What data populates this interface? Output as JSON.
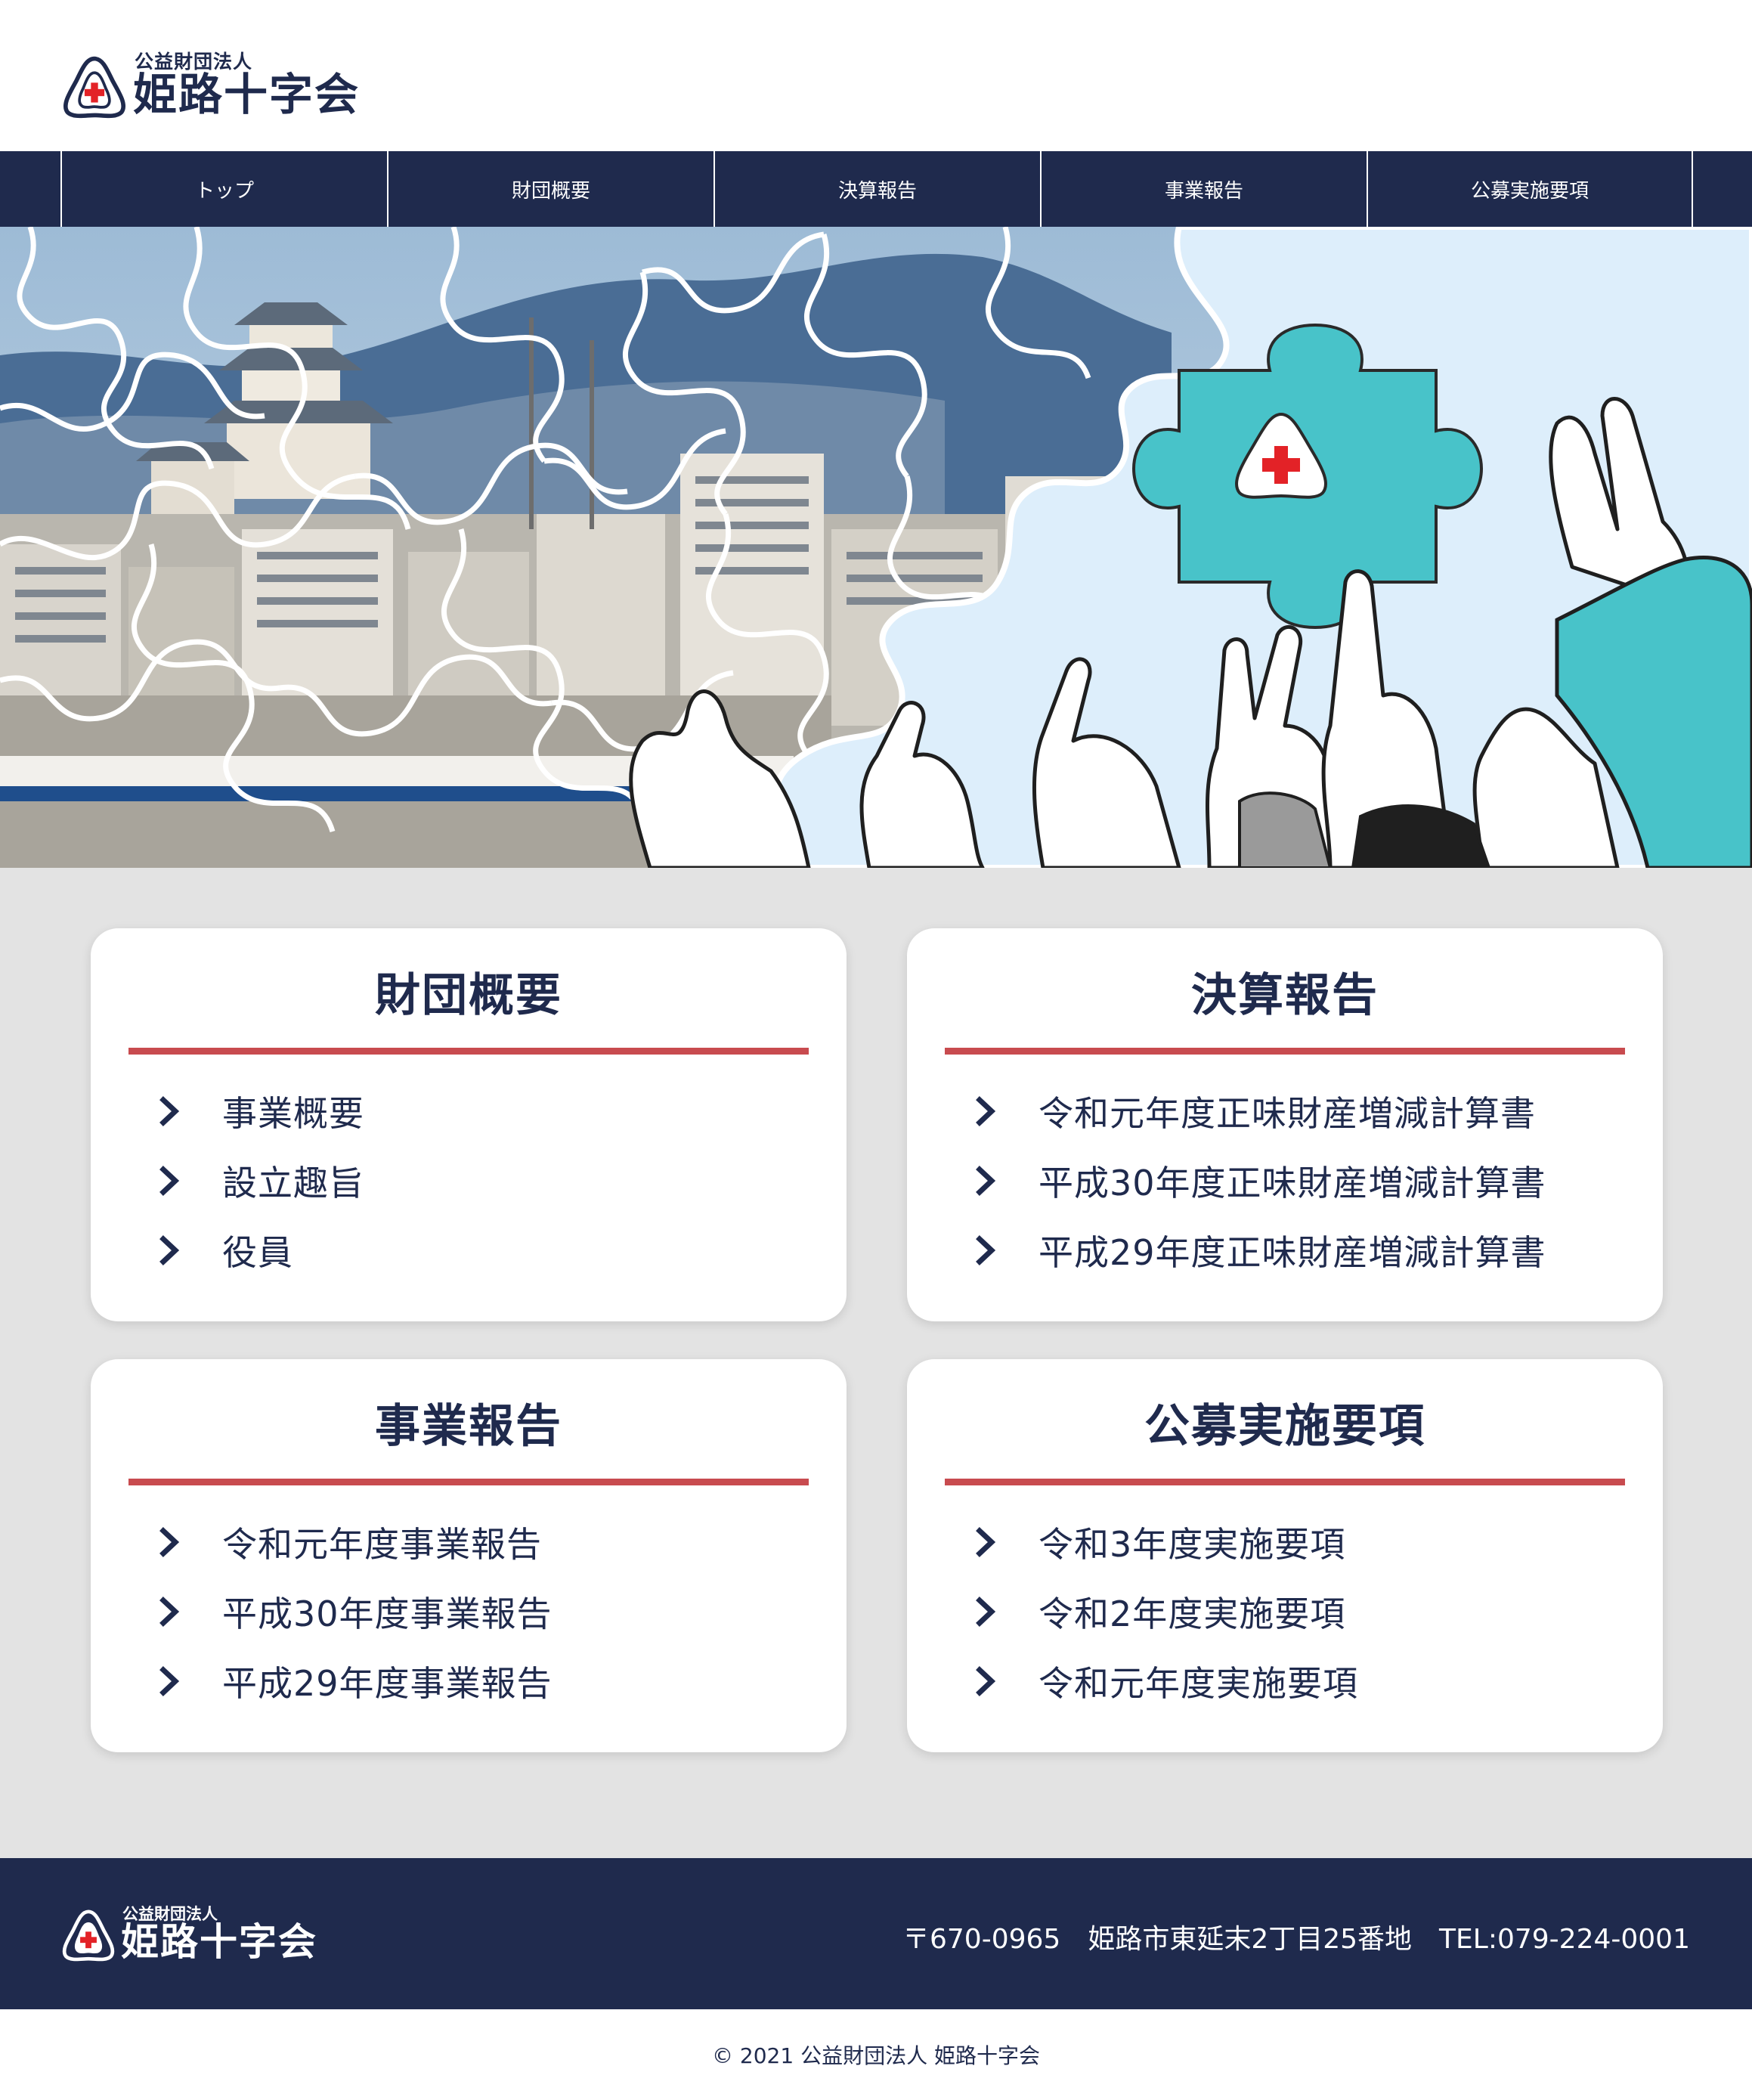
{
  "header": {
    "corp_type": "公益財団法人",
    "org_name": "姫路十字会"
  },
  "nav": {
    "items": [
      {
        "label": "トップ"
      },
      {
        "label": "財団概要"
      },
      {
        "label": "決算報告"
      },
      {
        "label": "事業報告"
      },
      {
        "label": "公募実施要項"
      }
    ]
  },
  "cards": [
    {
      "title": "財団概要",
      "links": [
        "事業概要",
        "設立趣旨",
        "役員"
      ]
    },
    {
      "title": "決算報告",
      "links": [
        "令和元年度正味財産増減計算書",
        "平成30年度正味財産増減計算書",
        "平成29年度正味財産増減計算書"
      ]
    },
    {
      "title": "事業報告",
      "links": [
        "令和元年度事業報告",
        "平成30年度事業報告",
        "平成29年度事業報告"
      ]
    },
    {
      "title": "公募実施要項",
      "links": [
        "令和3年度実施要項",
        "令和2年度実施要項",
        "令和元年度実施要項"
      ]
    }
  ],
  "footer": {
    "corp_type": "公益財団法人",
    "org_name": "姫路十字会",
    "postal": "〒670-0965",
    "address": "姫路市東延末2丁目25番地",
    "tel": "TEL:079-224-0001",
    "copyright": "© 2021 公益財団法人 姫路十字会"
  },
  "colors": {
    "navy": "#1f2a4d",
    "accent_red": "#c84b4f",
    "teal": "#48c3c9",
    "background": "#e3e3e3"
  }
}
